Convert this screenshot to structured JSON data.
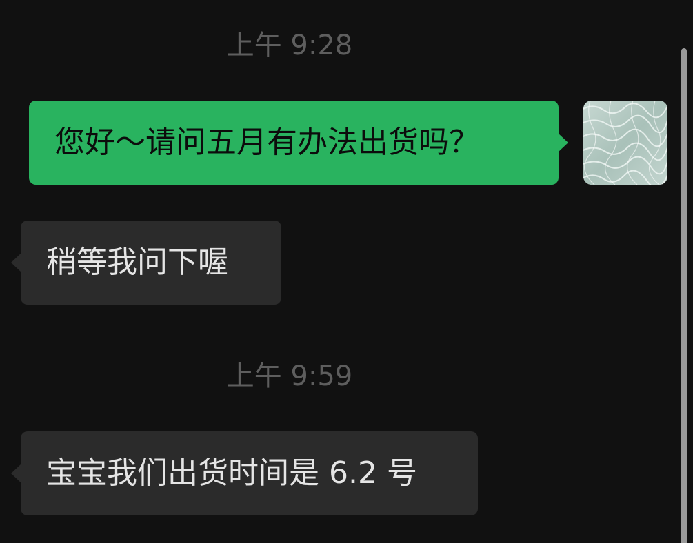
{
  "chat": {
    "messages": [
      {
        "type": "timestamp",
        "text": "上午 9:28"
      },
      {
        "type": "outgoing",
        "text": "您好～请问五月有办法出货吗？"
      },
      {
        "type": "incoming",
        "text": "稍等我问下喔"
      },
      {
        "type": "timestamp",
        "text": "上午 9:59"
      },
      {
        "type": "incoming",
        "text": "宝宝我们出货时间是 6.2 号"
      }
    ]
  },
  "avatar": {
    "icon": "water-texture-avatar"
  },
  "colors": {
    "background": "#111111",
    "outgoing_bubble": "#29b35f",
    "incoming_bubble": "#2b2b2b",
    "timestamp_text": "#5e5e5e"
  }
}
